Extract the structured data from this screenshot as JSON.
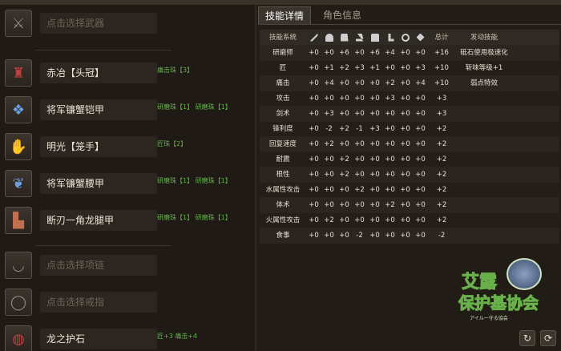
{
  "equipment": {
    "weapon": {
      "name": "点击选择武器",
      "tags": ""
    },
    "head": {
      "name": "赤冶【头冠】",
      "tags": "痛击珠【3】"
    },
    "body": {
      "name": "将军镰蟹铠甲",
      "tags": "研磨珠【1】 研磨珠【1】"
    },
    "arms": {
      "name": "明光【笼手】",
      "tags": "匠珠【2】"
    },
    "waist": {
      "name": "将军镰蟹腰甲",
      "tags": "研磨珠【1】 研磨珠【1】"
    },
    "legs": {
      "name": "断刃一角龙腿甲",
      "tags": "研磨珠【1】 研磨珠【1】"
    },
    "necklace": {
      "name": "点击选择项链",
      "tags": ""
    },
    "ring": {
      "name": "点击选择戒指",
      "tags": ""
    },
    "charm": {
      "name": "龙之护石",
      "tags": "匠+3 痛击+4"
    }
  },
  "tabs": {
    "active": "技能详情",
    "inactive": "角色信息"
  },
  "table": {
    "header": {
      "skill": "技能系统",
      "total": "总计",
      "effect": "发动技能"
    },
    "rows": [
      {
        "skill": "研磨师",
        "v": [
          "+0",
          "+0",
          "+6",
          "+0",
          "+6",
          "+4",
          "+0",
          "+0"
        ],
        "total": "+16",
        "effect": "砥石使用极速化"
      },
      {
        "skill": "匠",
        "v": [
          "+0",
          "+1",
          "+2",
          "+3",
          "+1",
          "+0",
          "+0",
          "+3"
        ],
        "total": "+10",
        "effect": "斩味等级+1"
      },
      {
        "skill": "痛击",
        "v": [
          "+0",
          "+4",
          "+0",
          "+0",
          "+0",
          "+2",
          "+0",
          "+4"
        ],
        "total": "+10",
        "effect": "弱点特效"
      },
      {
        "skill": "攻击",
        "v": [
          "+0",
          "+0",
          "+0",
          "+0",
          "+0",
          "+3",
          "+0",
          "+0"
        ],
        "total": "+3",
        "effect": ""
      },
      {
        "skill": "剑术",
        "v": [
          "+0",
          "+3",
          "+0",
          "+0",
          "+0",
          "+0",
          "+0",
          "+0"
        ],
        "total": "+3",
        "effect": ""
      },
      {
        "skill": "锋利度",
        "v": [
          "+0",
          "-2",
          "+2",
          "-1",
          "+3",
          "+0",
          "+0",
          "+0"
        ],
        "total": "+2",
        "effect": ""
      },
      {
        "skill": "回复速度",
        "v": [
          "+0",
          "+2",
          "+0",
          "+0",
          "+0",
          "+0",
          "+0",
          "+0"
        ],
        "total": "+2",
        "effect": ""
      },
      {
        "skill": "耐震",
        "v": [
          "+0",
          "+0",
          "+2",
          "+0",
          "+0",
          "+0",
          "+0",
          "+0"
        ],
        "total": "+2",
        "effect": ""
      },
      {
        "skill": "根性",
        "v": [
          "+0",
          "+0",
          "+2",
          "+0",
          "+0",
          "+0",
          "+0",
          "+0"
        ],
        "total": "+2",
        "effect": ""
      },
      {
        "skill": "水属性攻击",
        "v": [
          "+0",
          "+0",
          "+0",
          "+2",
          "+0",
          "+0",
          "+0",
          "+0"
        ],
        "total": "+2",
        "effect": ""
      },
      {
        "skill": "体术",
        "v": [
          "+0",
          "+0",
          "+0",
          "+0",
          "+0",
          "+2",
          "+0",
          "+0"
        ],
        "total": "+2",
        "effect": ""
      },
      {
        "skill": "火属性攻击",
        "v": [
          "+0",
          "+2",
          "+0",
          "+0",
          "+0",
          "+0",
          "+0",
          "+0"
        ],
        "total": "+2",
        "effect": ""
      },
      {
        "skill": "食事",
        "v": [
          "+0",
          "+0",
          "+0",
          "-2",
          "+0",
          "+0",
          "+0",
          "+0"
        ],
        "total": "-2",
        "effect": ""
      }
    ]
  },
  "logo": {
    "line1": "艾露",
    "line2": "保护基协会",
    "sub": "アイルー守る協会"
  },
  "buttons": {
    "share": "↻",
    "refresh": "⟳"
  }
}
